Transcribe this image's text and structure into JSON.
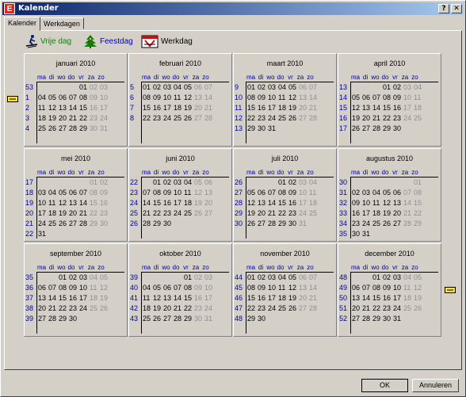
{
  "window": {
    "title": "Kalender",
    "app_icon": "E"
  },
  "titlebar_buttons": {
    "help": "?",
    "close": "✕"
  },
  "tabs": [
    "Kalender",
    "Werkdagen"
  ],
  "legend": {
    "vrije_dag": "Vrije dag",
    "feestdag": "Feestdag",
    "werkdag": "Werkdag"
  },
  "colors": {
    "vrije_dag": "#108010",
    "feestdag": "#0000c8",
    "week_numbers": "#0000a0",
    "weekend": "#909090"
  },
  "weekday_headers": [
    "ma",
    "di",
    "wo",
    "do",
    "vr",
    "za",
    "zo"
  ],
  "months": [
    {
      "title": "januari 2010",
      "weeks": [
        "53",
        "1",
        "2",
        "3",
        "4"
      ],
      "rows": [
        [
          "",
          "",
          "",
          "",
          1,
          2,
          3
        ],
        [
          4,
          5,
          6,
          7,
          8,
          9,
          10
        ],
        [
          11,
          12,
          13,
          14,
          15,
          16,
          17
        ],
        [
          18,
          19,
          20,
          21,
          22,
          23,
          24
        ],
        [
          25,
          26,
          27,
          28,
          29,
          30,
          31
        ]
      ]
    },
    {
      "title": "februari 2010",
      "weeks": [
        "5",
        "6",
        "7",
        "8"
      ],
      "rows": [
        [
          1,
          2,
          3,
          4,
          5,
          6,
          7
        ],
        [
          8,
          9,
          10,
          11,
          12,
          13,
          14
        ],
        [
          15,
          16,
          17,
          18,
          19,
          20,
          21
        ],
        [
          22,
          23,
          24,
          25,
          26,
          27,
          28
        ]
      ]
    },
    {
      "title": "maart 2010",
      "weeks": [
        "9",
        "10",
        "11",
        "12",
        "13"
      ],
      "rows": [
        [
          1,
          2,
          3,
          4,
          5,
          6,
          7
        ],
        [
          8,
          9,
          10,
          11,
          12,
          13,
          14
        ],
        [
          15,
          16,
          17,
          18,
          19,
          20,
          21
        ],
        [
          22,
          23,
          24,
          25,
          26,
          27,
          28
        ],
        [
          29,
          30,
          31,
          "",
          "",
          "",
          ""
        ]
      ]
    },
    {
      "title": "april 2010",
      "weeks": [
        "13",
        "14",
        "15",
        "16",
        "17"
      ],
      "rows": [
        [
          "",
          "",
          "",
          1,
          2,
          3,
          4
        ],
        [
          5,
          6,
          7,
          8,
          9,
          10,
          11
        ],
        [
          12,
          13,
          14,
          15,
          16,
          17,
          18
        ],
        [
          19,
          20,
          21,
          22,
          23,
          24,
          25
        ],
        [
          26,
          27,
          28,
          29,
          30,
          "",
          ""
        ]
      ]
    },
    {
      "title": "mei 2010",
      "weeks": [
        "17",
        "18",
        "19",
        "20",
        "21",
        "22"
      ],
      "rows": [
        [
          "",
          "",
          "",
          "",
          "",
          1,
          2
        ],
        [
          3,
          4,
          5,
          6,
          7,
          8,
          9
        ],
        [
          10,
          11,
          12,
          13,
          14,
          15,
          16
        ],
        [
          17,
          18,
          19,
          20,
          21,
          22,
          23
        ],
        [
          24,
          25,
          26,
          27,
          28,
          29,
          30
        ],
        [
          31,
          "",
          "",
          "",
          "",
          "",
          ""
        ]
      ]
    },
    {
      "title": "juni 2010",
      "weeks": [
        "22",
        "23",
        "24",
        "25",
        "26"
      ],
      "rows": [
        [
          "",
          1,
          2,
          3,
          4,
          5,
          6
        ],
        [
          7,
          8,
          9,
          10,
          11,
          12,
          13
        ],
        [
          14,
          15,
          16,
          17,
          18,
          19,
          20
        ],
        [
          21,
          22,
          23,
          24,
          25,
          26,
          27
        ],
        [
          28,
          29,
          30,
          "",
          "",
          "",
          ""
        ]
      ]
    },
    {
      "title": "juli 2010",
      "weeks": [
        "26",
        "27",
        "28",
        "29",
        "30"
      ],
      "rows": [
        [
          "",
          "",
          "",
          1,
          2,
          3,
          4
        ],
        [
          5,
          6,
          7,
          8,
          9,
          10,
          11
        ],
        [
          12,
          13,
          14,
          15,
          16,
          17,
          18
        ],
        [
          19,
          20,
          21,
          22,
          23,
          24,
          25
        ],
        [
          26,
          27,
          28,
          29,
          30,
          31,
          ""
        ]
      ]
    },
    {
      "title": "augustus 2010",
      "weeks": [
        "30",
        "31",
        "32",
        "33",
        "34",
        "35"
      ],
      "rows": [
        [
          "",
          "",
          "",
          "",
          "",
          "",
          1
        ],
        [
          2,
          3,
          4,
          5,
          6,
          7,
          8
        ],
        [
          9,
          10,
          11,
          12,
          13,
          14,
          15
        ],
        [
          16,
          17,
          18,
          19,
          20,
          21,
          22
        ],
        [
          23,
          24,
          25,
          26,
          27,
          28,
          29
        ],
        [
          30,
          31,
          "",
          "",
          "",
          "",
          ""
        ]
      ]
    },
    {
      "title": "september 2010",
      "weeks": [
        "35",
        "36",
        "37",
        "38",
        "39"
      ],
      "rows": [
        [
          "",
          "",
          1,
          2,
          3,
          4,
          5
        ],
        [
          6,
          7,
          8,
          9,
          10,
          11,
          12
        ],
        [
          13,
          14,
          15,
          16,
          17,
          18,
          19
        ],
        [
          20,
          21,
          22,
          23,
          24,
          25,
          26
        ],
        [
          27,
          28,
          29,
          30,
          "",
          "",
          ""
        ]
      ]
    },
    {
      "title": "oktober 2010",
      "weeks": [
        "39",
        "40",
        "41",
        "42",
        "43"
      ],
      "rows": [
        [
          "",
          "",
          "",
          "",
          1,
          2,
          3
        ],
        [
          4,
          5,
          6,
          7,
          8,
          9,
          10
        ],
        [
          11,
          12,
          13,
          14,
          15,
          16,
          17
        ],
        [
          18,
          19,
          20,
          21,
          22,
          23,
          24
        ],
        [
          25,
          26,
          27,
          28,
          29,
          30,
          31
        ]
      ]
    },
    {
      "title": "november 2010",
      "weeks": [
        "44",
        "45",
        "46",
        "47",
        "48"
      ],
      "rows": [
        [
          1,
          2,
          3,
          4,
          5,
          6,
          7
        ],
        [
          8,
          9,
          10,
          11,
          12,
          13,
          14
        ],
        [
          15,
          16,
          17,
          18,
          19,
          20,
          21
        ],
        [
          22,
          23,
          24,
          25,
          26,
          27,
          28
        ],
        [
          29,
          30,
          "",
          "",
          "",
          "",
          ""
        ]
      ]
    },
    {
      "title": "december 2010",
      "weeks": [
        "48",
        "49",
        "50",
        "51",
        "52"
      ],
      "rows": [
        [
          "",
          "",
          1,
          2,
          3,
          4,
          5
        ],
        [
          6,
          7,
          8,
          9,
          10,
          11,
          12
        ],
        [
          13,
          14,
          15,
          16,
          17,
          18,
          19
        ],
        [
          20,
          21,
          22,
          23,
          24,
          25,
          26
        ],
        [
          27,
          28,
          29,
          30,
          31,
          "",
          ""
        ]
      ]
    }
  ],
  "nav": {
    "prev_icon": "hand-left-icon",
    "next_icon": "hand-right-icon"
  },
  "buttons": {
    "ok": "OK",
    "cancel": "Annuleren"
  }
}
